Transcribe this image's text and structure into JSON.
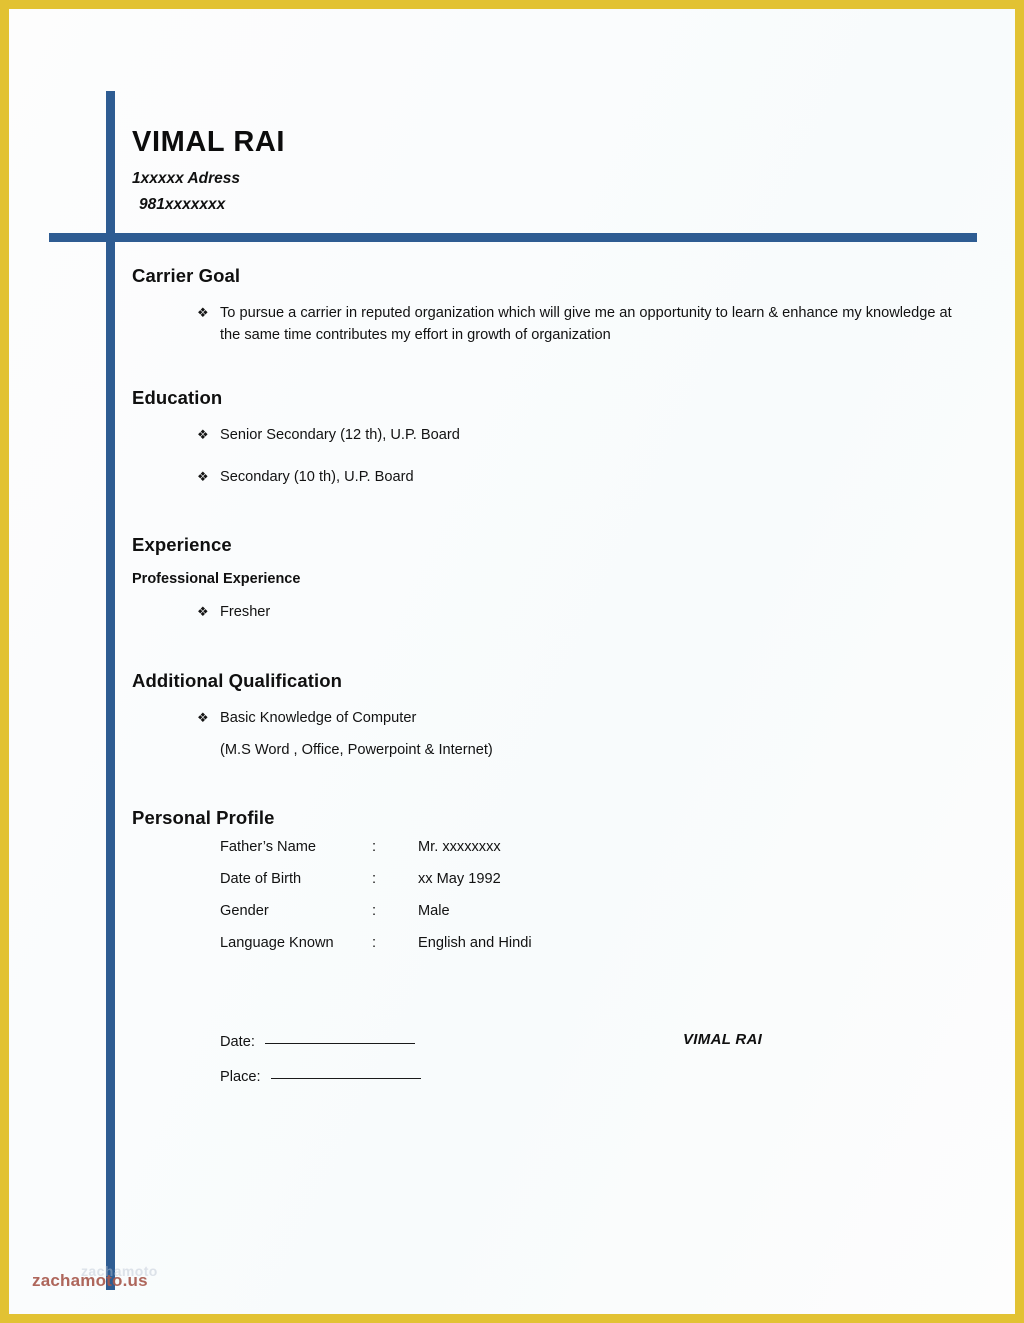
{
  "document": {
    "type": "resume",
    "accent_color": "#2E5C92",
    "frame_color": "#E2C233",
    "bullet_glyph": "❖"
  },
  "header": {
    "name": "VIMAL RAI",
    "address": "1xxxxx Adress",
    "phone": "981xxxxxxx"
  },
  "sections": {
    "carrier_goal": {
      "title": "Carrier Goal",
      "bullets": [
        "To pursue a carrier in reputed organization which will give me an opportunity to learn & enhance my knowledge at the same time contributes my effort in growth of organization"
      ]
    },
    "education": {
      "title": "Education",
      "bullets": [
        "Senior Secondary (12 th), U.P. Board",
        "Secondary (10 th), U.P. Board"
      ]
    },
    "experience": {
      "title": "Experience",
      "subtitle": "Professional Experience",
      "bullets": [
        "Fresher"
      ]
    },
    "additional_qualification": {
      "title": "Additional Qualification",
      "bullets": [
        "Basic Knowledge of Computer"
      ],
      "continuation": "(M.S Word , Office, Powerpoint & Internet)"
    },
    "personal_profile": {
      "title": "Personal Profile",
      "separator": ":",
      "rows": [
        {
          "label": "Father’s Name",
          "value": "Mr. xxxxxxxx"
        },
        {
          "label": "Date of Birth",
          "value": "xx  May 1992"
        },
        {
          "label": "Gender",
          "value": "Male"
        },
        {
          "label": "Language Known",
          "value": "English and Hindi"
        }
      ]
    }
  },
  "signature": {
    "date_label": "Date:",
    "place_label": "Place:",
    "name": "VIMAL RAI"
  },
  "watermark": {
    "primary": "zachamoto.us",
    "ghost": "zachamoto"
  }
}
